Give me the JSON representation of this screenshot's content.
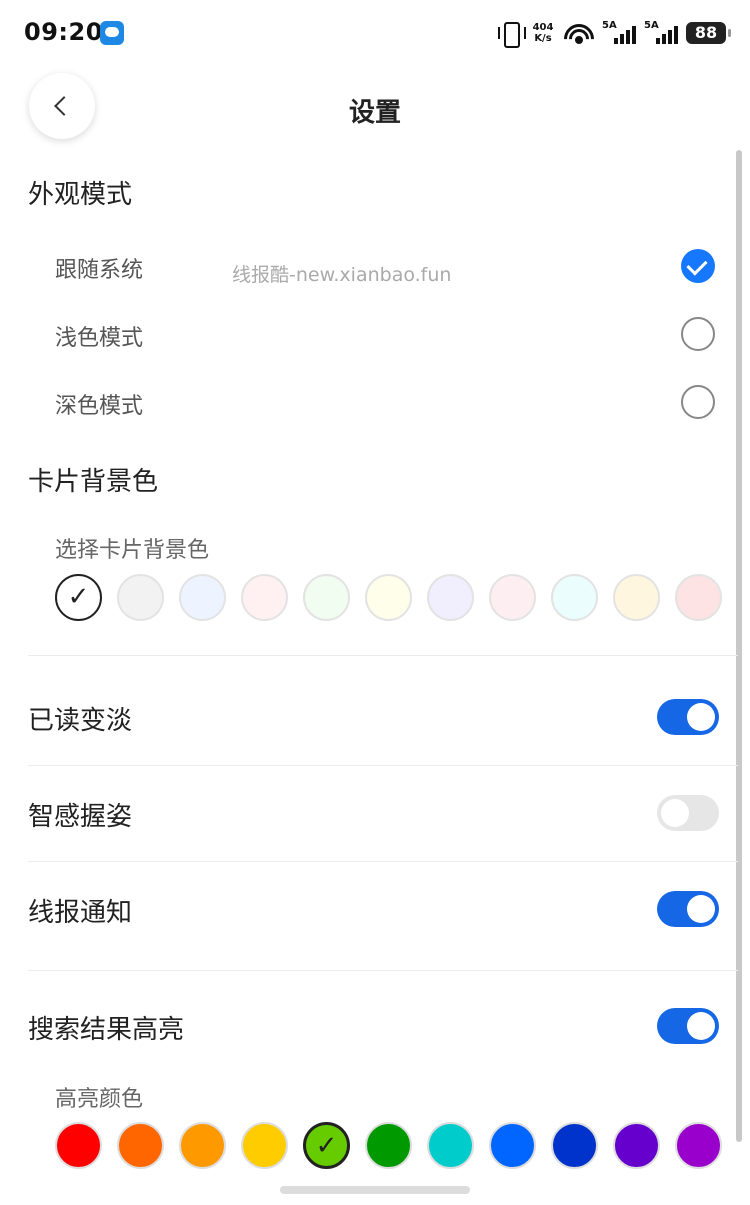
{
  "status_bar": {
    "time": "09:20",
    "speed_value": "404",
    "speed_unit": "K/s",
    "signal1_label": "5A",
    "signal2_label": "5A",
    "battery": "88"
  },
  "header": {
    "title": "设置"
  },
  "appearance": {
    "title": "外观模式",
    "options": [
      {
        "label": "跟随系统",
        "checked": true
      },
      {
        "label": "浅色模式",
        "checked": false
      },
      {
        "label": "深色模式",
        "checked": false
      }
    ]
  },
  "watermark": "线报酷-new.xianbao.fun",
  "card_bg": {
    "title": "卡片背景色",
    "sub_label": "选择卡片背景色",
    "check_glyph": "✓",
    "colors": [
      "#ffffff",
      "#f2f2f2",
      "#eef4ff",
      "#fff1f1",
      "#f1fdf1",
      "#fefeea",
      "#f1eefe",
      "#fdeef2",
      "#ecfdfd",
      "#fff6e0",
      "#fde3e3"
    ]
  },
  "toggles": {
    "read_fade": {
      "label": "已读变淡",
      "on": true
    },
    "smart_grip": {
      "label": "智感握姿",
      "on": false
    },
    "deal_notify": {
      "label": "线报通知",
      "on": true
    },
    "search_highlight": {
      "label": "搜索结果高亮",
      "on": true
    }
  },
  "highlight": {
    "sub_label": "高亮颜色",
    "check_glyph": "✓",
    "colors": [
      "#ff0000",
      "#ff6600",
      "#ff9900",
      "#ffcc00",
      "#66cc00",
      "#009900",
      "#00cccc",
      "#0066ff",
      "#0033cc",
      "#6600cc",
      "#9900cc"
    ]
  }
}
